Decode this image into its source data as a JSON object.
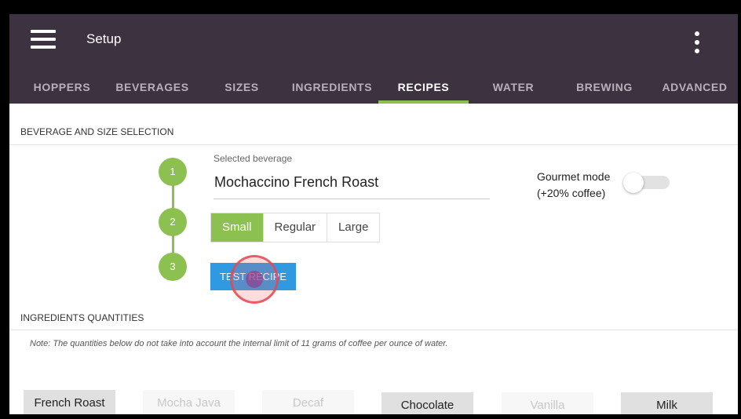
{
  "app": {
    "title": "Setup",
    "menu_icon": "hamburger-menu-icon",
    "more_icon": "more-vert-icon"
  },
  "tabs": [
    {
      "label": "HOPPERS",
      "active": false
    },
    {
      "label": "BEVERAGES",
      "active": false
    },
    {
      "label": "SIZES",
      "active": false
    },
    {
      "label": "INGREDIENTS",
      "active": false
    },
    {
      "label": "RECIPES",
      "active": true
    },
    {
      "label": "WATER",
      "active": false
    },
    {
      "label": "BREWING",
      "active": false
    },
    {
      "label": "ADVANCED",
      "active": false
    }
  ],
  "selection": {
    "section_label": "BEVERAGE AND SIZE SELECTION",
    "steps": [
      "1",
      "2",
      "3"
    ],
    "beverage_caption": "Selected beverage",
    "beverage_value": "Mochaccino French Roast",
    "gourmet_label": "Gourmet mode",
    "gourmet_sub": "(+20% coffee)",
    "gourmet_on": false,
    "sizes": [
      {
        "label": "Small",
        "selected": true
      },
      {
        "label": "Regular",
        "selected": false
      },
      {
        "label": "Large",
        "selected": false
      }
    ],
    "test_button": "TEST RECIPE"
  },
  "ingredients": {
    "section_label": "INGREDIENTS QUANTITIES",
    "note": "Note: The quantities below do not take into account the internal limit of 11 grams of coffee per ounce of water.",
    "items": [
      {
        "label": "French Roast",
        "enabled": true
      },
      {
        "label": "Mocha Java",
        "enabled": false
      },
      {
        "label": "Decaf",
        "enabled": false
      },
      {
        "label": "Chocolate",
        "enabled": true
      },
      {
        "label": "Vanilla",
        "enabled": false
      },
      {
        "label": "Milk",
        "enabled": true
      }
    ]
  },
  "colors": {
    "app_bar": "#3d3340",
    "accent_green": "#8cc152",
    "button_blue": "#2f9ae2"
  }
}
